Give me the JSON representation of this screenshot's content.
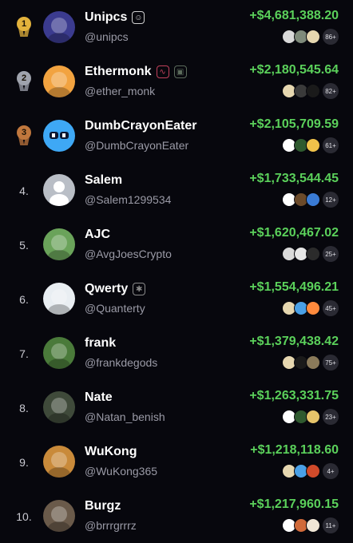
{
  "colors": {
    "background": "#07070d",
    "pnl_green": "#5bd15b",
    "handle_gray": "#9a9aa6",
    "gold": "#e3b23c",
    "silver": "#9fa3ad",
    "bronze": "#c0773d"
  },
  "traders": [
    {
      "rank": "1",
      "medal": "gold",
      "name": "Unipcs",
      "handle": "@unipcs",
      "pnl": "+$4,681,388.20",
      "more": "86+",
      "avatar_color": "#3b3b8f",
      "avatar_icon": "robot-avatar",
      "badges": [
        {
          "icon": "profile-badge-icon",
          "color": "#cfcfcf",
          "glyph": "☺"
        }
      ],
      "nfts": [
        "#d9d9d9",
        "#7e8a7a",
        "#e6d7b0"
      ]
    },
    {
      "rank": "2",
      "medal": "silver",
      "name": "Ethermonk",
      "handle": "@ether_monk",
      "pnl": "+$2,180,545.64",
      "more": "82+",
      "avatar_color": "#f2a340",
      "avatar_icon": "penguin-avatar",
      "badges": [
        {
          "icon": "drawing-badge-icon",
          "color": "#c0405a",
          "glyph": "∿"
        },
        {
          "icon": "pixel-badge-icon",
          "color": "#5b6b5b",
          "glyph": "▣"
        }
      ],
      "nfts": [
        "#e6d7b0",
        "#3a3a3a",
        "#1a1a1a"
      ]
    },
    {
      "rank": "3",
      "medal": "bronze",
      "name": "DumbCrayonEater",
      "handle": "@DumbCrayonEater",
      "pnl": "+$2,105,709.59",
      "more": "61+",
      "avatar_color": "#3ea8f5",
      "avatar_icon": "goggles-avatar",
      "badges": [],
      "nfts": [
        "#ffffff",
        "#2f5a2f",
        "#f0c24a"
      ]
    },
    {
      "rank": "4.",
      "medal": "",
      "name": "Salem",
      "handle": "@Salem1299534",
      "pnl": "+$1,733,544.45",
      "more": "12+",
      "avatar_color": "#b9bec6",
      "avatar_icon": "default-user-avatar",
      "badges": [],
      "nfts": [
        "#ffffff",
        "#6b4a2a",
        "#3a7bd5"
      ]
    },
    {
      "rank": "5.",
      "medal": "",
      "name": "AJC",
      "handle": "@AvgJoesCrypto",
      "pnl": "+$1,620,467.02",
      "more": "25+",
      "avatar_color": "#6aa35a",
      "avatar_icon": "ape-avatar",
      "badges": [],
      "nfts": [
        "#d9d9d9",
        "#e6e6e6",
        "#2b2b2b"
      ]
    },
    {
      "rank": "6.",
      "medal": "",
      "name": "Qwerty",
      "handle": "@Quanterty",
      "pnl": "+$1,554,496.21",
      "more": "45+",
      "avatar_color": "#e9eef2",
      "avatar_icon": "ghost-avatar",
      "badges": [
        {
          "icon": "verified-badge-icon",
          "color": "#8a8a8a",
          "glyph": "✱"
        }
      ],
      "nfts": [
        "#e6d7b0",
        "#4aa0e6",
        "#ff8a3d"
      ]
    },
    {
      "rank": "7.",
      "medal": "",
      "name": "frank",
      "handle": "@frankdegods",
      "pnl": "+$1,379,438.42",
      "more": "75+",
      "avatar_color": "#4a7a3a",
      "avatar_icon": "simpson-avatar",
      "badges": [],
      "nfts": [
        "#e6d7b0",
        "#1a1a1a",
        "#8a7a5a"
      ]
    },
    {
      "rank": "8.",
      "medal": "",
      "name": "Nate",
      "handle": "@Natan_benish",
      "pnl": "+$1,263,331.75",
      "more": "23+",
      "avatar_color": "#3f4a3a",
      "avatar_icon": "photo-avatar",
      "badges": [],
      "nfts": [
        "#ffffff",
        "#2f5a2f",
        "#e6c46a"
      ]
    },
    {
      "rank": "9.",
      "medal": "",
      "name": "WuKong",
      "handle": "@WuKong365",
      "pnl": "+$1,218,118.60",
      "more": "4+",
      "avatar_color": "#c98a3a",
      "avatar_icon": "anime-avatar",
      "badges": [],
      "nfts": [
        "#e6d7b0",
        "#4aa0e6",
        "#d04a2a"
      ]
    },
    {
      "rank": "10.",
      "medal": "",
      "name": "Burgz",
      "handle": "@brrrgrrrz",
      "pnl": "+$1,217,960.15",
      "more": "11+",
      "avatar_color": "#6a5a4a",
      "avatar_icon": "room-photo-avatar",
      "badges": [],
      "nfts": [
        "#ffffff",
        "#d06a3a",
        "#f0e6d6"
      ]
    }
  ]
}
